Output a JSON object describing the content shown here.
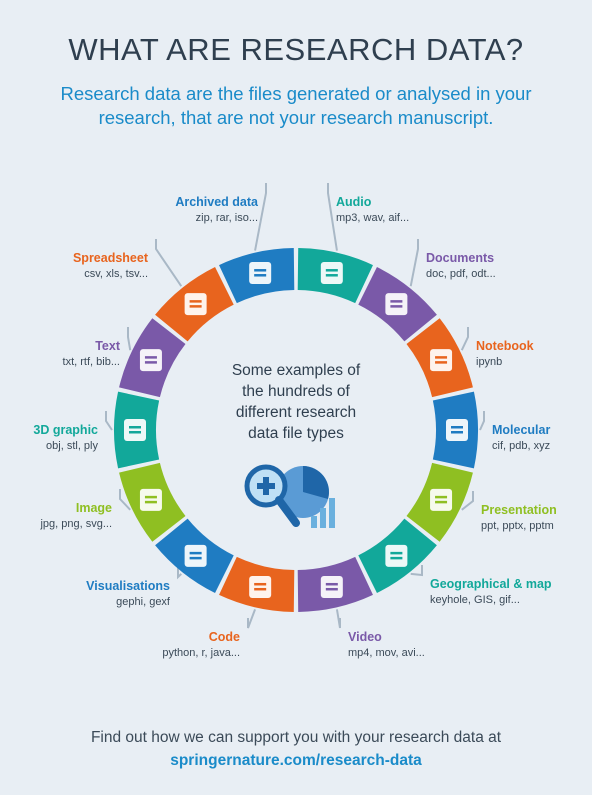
{
  "title": "WHAT ARE RESEARCH DATA?",
  "subtitle": "Research data are the files generated or analysed in your research, that are not your research manuscript.",
  "center_lines": [
    "Some examples of",
    "the hundreds of",
    "different research",
    "data file types"
  ],
  "file_types": [
    {
      "label": "Audio",
      "formats": "mp3, wav, aif...",
      "color": "#12a89a",
      "icon": "headphones-icon"
    },
    {
      "label": "Documents",
      "formats": "doc, pdf, odt...",
      "color": "#7a59a8",
      "icon": "documents-icon"
    },
    {
      "label": "Notebook",
      "formats": "ipynb",
      "color": "#e8641e",
      "icon": "notebook-icon"
    },
    {
      "label": "Molecular",
      "formats": "cif, pdb, xyz",
      "color": "#1f7cc2",
      "icon": "atom-icon"
    },
    {
      "label": "Presentation",
      "formats": "ppt, pptx, pptm",
      "color": "#8fbf22",
      "icon": "presentation-icon"
    },
    {
      "label": "Geographical & map",
      "formats": "keyhole, GIS, gif...",
      "color": "#12a89a",
      "icon": "map-icon"
    },
    {
      "label": "Video",
      "formats": "mp4, mov, avi...",
      "color": "#7a59a8",
      "icon": "video-icon"
    },
    {
      "label": "Code",
      "formats": "python, r, java...",
      "color": "#e8641e",
      "icon": "code-icon"
    },
    {
      "label": "Visualisations",
      "formats": "gephi, gexf",
      "color": "#1f7cc2",
      "icon": "eye-icon"
    },
    {
      "label": "Image",
      "formats": "jpg, png, svg...",
      "color": "#8fbf22",
      "icon": "image-icon"
    },
    {
      "label": "3D graphic",
      "formats": "obj, stl, ply",
      "color": "#12a89a",
      "icon": "layers-icon"
    },
    {
      "label": "Text",
      "formats": "txt, rtf, bib...",
      "color": "#7a59a8",
      "icon": "text-file-icon"
    },
    {
      "label": "Spreadsheet",
      "formats": "csv, xls, tsv...",
      "color": "#e8641e",
      "icon": "spreadsheet-icon"
    },
    {
      "label": "Archived data",
      "formats": "zip, rar, iso...",
      "color": "#1f7cc2",
      "icon": "archive-box-icon"
    }
  ],
  "footer": {
    "text": "Find out how we can support you with your research data at",
    "link": "springernature.com/research-data"
  }
}
